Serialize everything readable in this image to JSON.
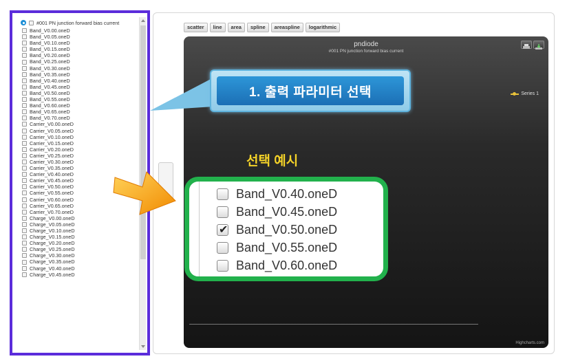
{
  "list": {
    "header": "#001 PN junction forward bias current",
    "items": [
      "Band_V0.00.oneD",
      "Band_V0.05.oneD",
      "Band_V0.10.oneD",
      "Band_V0.15.oneD",
      "Band_V0.20.oneD",
      "Band_V0.25.oneD",
      "Band_V0.30.oneD",
      "Band_V0.35.oneD",
      "Band_V0.40.oneD",
      "Band_V0.45.oneD",
      "Band_V0.50.oneD",
      "Band_V0.55.oneD",
      "Band_V0.60.oneD",
      "Band_V0.65.oneD",
      "Band_V0.70.oneD",
      "Carrier_V0.00.oneD",
      "Carrier_V0.05.oneD",
      "Carrier_V0.10.oneD",
      "Carrier_V0.15.oneD",
      "Carrier_V0.20.oneD",
      "Carrier_V0.25.oneD",
      "Carrier_V0.30.oneD",
      "Carrier_V0.35.oneD",
      "Carrier_V0.40.oneD",
      "Carrier_V0.45.oneD",
      "Carrier_V0.50.oneD",
      "Carrier_V0.55.oneD",
      "Carrier_V0.60.oneD",
      "Carrier_V0.65.oneD",
      "Carrier_V0.70.oneD",
      "Charge_V0.00.oneD",
      "Charge_V0.05.oneD",
      "Charge_V0.10.oneD",
      "Charge_V0.15.oneD",
      "Charge_V0.20.oneD",
      "Charge_V0.25.oneD",
      "Charge_V0.30.oneD",
      "Charge_V0.35.oneD",
      "Charge_V0.40.oneD",
      "Charge_V0.45.oneD"
    ]
  },
  "toolbar": {
    "buttons": [
      "scatter",
      "line",
      "area",
      "spline",
      "areaspline",
      "logarithmic"
    ]
  },
  "chart": {
    "title": "pndiode",
    "subtitle": "#001 PN junction forward bias current",
    "legend": "Series 1",
    "credits": "Highcharts.com"
  },
  "callout": {
    "text": "1. 출력 파라미터 선택"
  },
  "example": {
    "label": "선택 예시",
    "items": [
      {
        "label": "Band_V0.40.oneD",
        "checked": false
      },
      {
        "label": "Band_V0.45.oneD",
        "checked": false
      },
      {
        "label": "Band_V0.50.oneD",
        "checked": true
      },
      {
        "label": "Band_V0.55.oneD",
        "checked": false
      },
      {
        "label": "Band_V0.60.oneD",
        "checked": false
      }
    ]
  },
  "colors": {
    "left_panel_border": "#5b2cdb",
    "zoom_border": "#22b14c",
    "example_label": "#f5d328",
    "callout": "#1c6fb5",
    "legend_series": "#e8c23a"
  }
}
